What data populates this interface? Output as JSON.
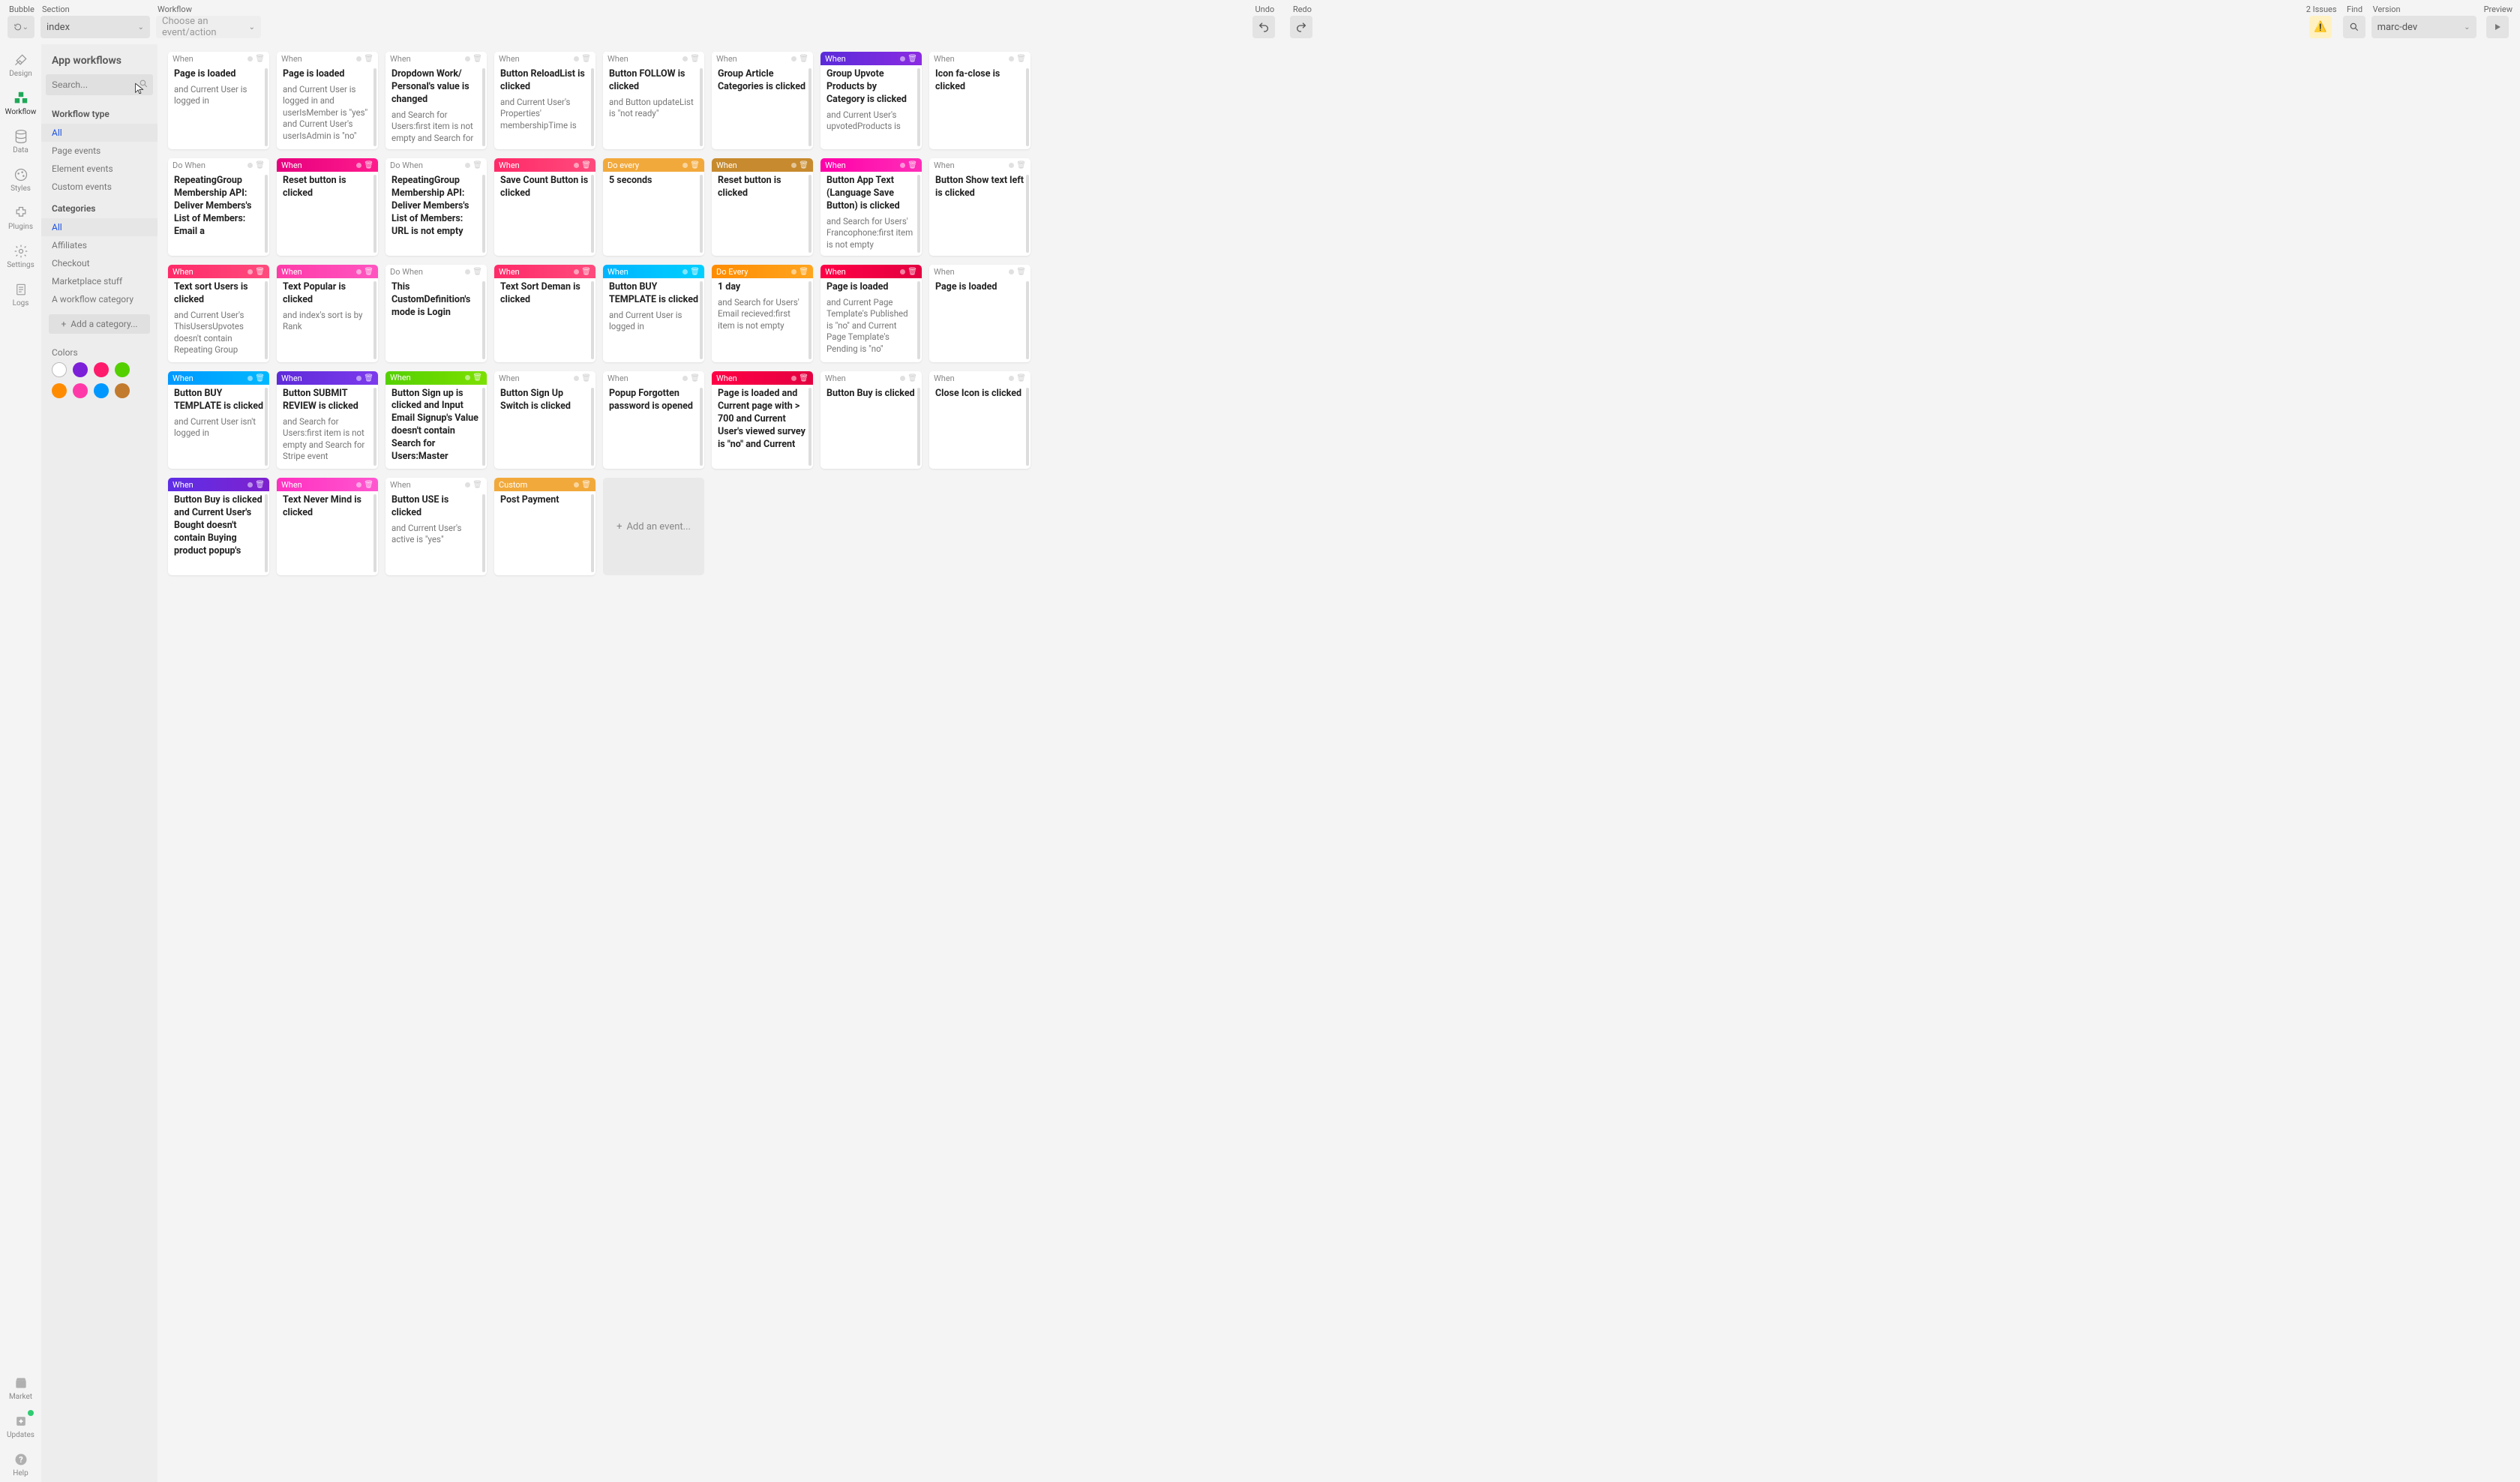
{
  "topbar": {
    "bubble_label": "Bubble",
    "section_label": "Section",
    "section_value": "index",
    "workflow_label": "Workflow",
    "workflow_placeholder": "Choose an event/action",
    "undo_label": "Undo",
    "redo_label": "Redo",
    "issues_label": "2 Issues",
    "find_label": "Find",
    "version_label": "Version",
    "version_value": "marc-dev",
    "preview_label": "Preview"
  },
  "rail": {
    "items": [
      {
        "id": "design",
        "label": "Design"
      },
      {
        "id": "workflow",
        "label": "Workflow"
      },
      {
        "id": "data",
        "label": "Data"
      },
      {
        "id": "styles",
        "label": "Styles"
      },
      {
        "id": "plugins",
        "label": "Plugins"
      },
      {
        "id": "settings",
        "label": "Settings"
      },
      {
        "id": "logs",
        "label": "Logs"
      }
    ],
    "bottom": [
      {
        "id": "market",
        "label": "Market"
      },
      {
        "id": "updates",
        "label": "Updates"
      },
      {
        "id": "help",
        "label": "Help"
      }
    ]
  },
  "panel": {
    "title": "App workflows",
    "search_placeholder": "Search...",
    "type_heading": "Workflow type",
    "types": [
      "All",
      "Page events",
      "Element events",
      "Custom events"
    ],
    "cat_heading": "Categories",
    "categories": [
      "All",
      "Affiliates",
      "Checkout",
      "Marketplace stuff",
      "A workflow category"
    ],
    "add_cat": "Add a category...",
    "colors_heading": "Colors",
    "colors": [
      "#ffffff",
      "#7c1fd9",
      "#ff1b6b",
      "#54d000",
      "#ff8c00",
      "#ff3aa8",
      "#0098ff",
      "#c27a2e"
    ]
  },
  "cards": [
    {
      "head": "When",
      "color": "c-gray",
      "title": "Page is loaded",
      "sub": "and Current User is logged in"
    },
    {
      "head": "When",
      "color": "c-gray",
      "title": "Page is loaded",
      "sub": "and Current User is logged in and userIsMember is \"yes\" and Current User's userIsAdmin is \"no\""
    },
    {
      "head": "When",
      "color": "c-gray",
      "title": "Dropdown Work/ Personal's value is changed",
      "sub": "and Search for Users:first item is not empty and Search for"
    },
    {
      "head": "When",
      "color": "c-gray",
      "title": "Button ReloadList is clicked",
      "sub": "and Current User's Properties' membershipTime is"
    },
    {
      "head": "When",
      "color": "c-gray",
      "title": "Button FOLLOW is clicked",
      "sub": "and Button updateList is \"not ready\""
    },
    {
      "head": "When",
      "color": "c-gray",
      "title": "Group Article Categories is clicked",
      "sub": ""
    },
    {
      "head": "When",
      "color": "c-purple-dk",
      "title": "Group Upvote Products by Category is clicked",
      "sub": "and Current User's upvotedProducts is"
    },
    {
      "head": "When",
      "color": "c-gray",
      "title": "Icon fa-close is clicked",
      "sub": ""
    },
    {
      "head": "Do When",
      "color": "c-gray",
      "title": "RepeatingGroup Membership API: Deliver Members's List of Members: Email a",
      "sub": ""
    },
    {
      "head": "When",
      "color": "c-pink-dk",
      "title": "Reset button is clicked",
      "sub": ""
    },
    {
      "head": "Do When",
      "color": "c-gray",
      "title": "RepeatingGroup Membership API: Deliver Members's List of Members: URL is not empty",
      "sub": ""
    },
    {
      "head": "When",
      "color": "c-hotpink",
      "title": "Save Count Button is clicked",
      "sub": ""
    },
    {
      "head": "Do every",
      "color": "c-amber",
      "title": "5 seconds",
      "sub": ""
    },
    {
      "head": "When",
      "color": "c-ocher",
      "title": "Reset button is clicked",
      "sub": ""
    },
    {
      "head": "When",
      "color": "c-magenta",
      "title": "Button App Text (Language Save Button) is clicked",
      "sub": "and Search for Users' Francophone:first item is not empty"
    },
    {
      "head": "When",
      "color": "c-gray",
      "title": "Button Show text left is clicked",
      "sub": ""
    },
    {
      "head": "When",
      "color": "c-hotpink",
      "title": "Text sort Users is clicked",
      "sub": "and Current User's ThisUsersUpvotes doesn't contain Repeating Group"
    },
    {
      "head": "When",
      "color": "c-pink2",
      "title": "Text Popular is clicked",
      "sub": "and index's sort is by Rank"
    },
    {
      "head": "Do When",
      "color": "c-gray",
      "title": "This CustomDefinition's mode is Login",
      "sub": ""
    },
    {
      "head": "When",
      "color": "c-hotpink",
      "title": "Text Sort Deman is clicked",
      "sub": ""
    },
    {
      "head": "When",
      "color": "c-cyan",
      "title": "Button BUY TEMPLATE is clicked",
      "sub": "and Current User is logged in"
    },
    {
      "head": "Do Every",
      "color": "c-orange",
      "title": "1 day",
      "sub": "and Search for Users' Email recieved:first item is not empty"
    },
    {
      "head": "When",
      "color": "c-red",
      "title": "Page is loaded",
      "sub": "and Current Page Template's Published is \"no\" and Current Page Template's Pending is \"no\""
    },
    {
      "head": "When",
      "color": "c-gray",
      "title": "Page is loaded",
      "sub": ""
    },
    {
      "head": "When",
      "color": "c-blue",
      "title": "Button BUY TEMPLATE is clicked",
      "sub": "and Current User isn't logged in"
    },
    {
      "head": "When",
      "color": "c-violet",
      "title": "Button SUBMIT REVIEW is clicked",
      "sub": "and Search for Users:first item is not empty and Search for Stripe event"
    },
    {
      "head": "When",
      "color": "c-green",
      "title": "Button Sign up is clicked and Input Email Signup's Value doesn't contain Search for Users:Master",
      "sub": ""
    },
    {
      "head": "When",
      "color": "c-gray",
      "title": "Button Sign Up Switch is clicked",
      "sub": ""
    },
    {
      "head": "When",
      "color": "c-gray",
      "title": "Popup Forgotten password is opened",
      "sub": ""
    },
    {
      "head": "When",
      "color": "c-red",
      "title": "Page is loaded and Current page with > 700 and Current User's viewed survey is \"no\" and Current",
      "sub": ""
    },
    {
      "head": "When",
      "color": "c-gray",
      "title": "Button Buy is clicked",
      "sub": ""
    },
    {
      "head": "When",
      "color": "c-gray",
      "title": "Close Icon is clicked",
      "sub": ""
    },
    {
      "head": "When",
      "color": "c-purple2",
      "title": "Button Buy is clicked and Current User's Bought doesn't contain Buying product popup's",
      "sub": ""
    },
    {
      "head": "When",
      "color": "c-pink3",
      "title": "Text Never Mind is clicked",
      "sub": ""
    },
    {
      "head": "When",
      "color": "c-gray",
      "title": "Button USE is clicked",
      "sub": "and Current User's active is \"yes\""
    },
    {
      "head": "Custom",
      "color": "c-amber",
      "title": "Post Payment",
      "sub": ""
    }
  ],
  "add_event": "Add an event..."
}
